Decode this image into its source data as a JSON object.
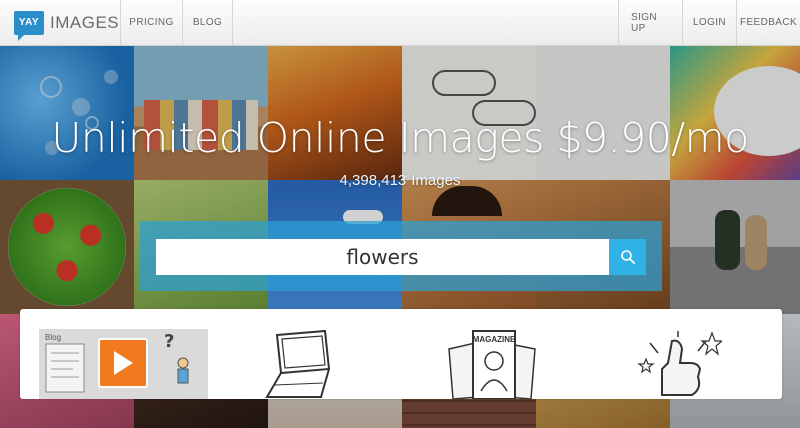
{
  "brand": {
    "logo_text": "YAY",
    "name": "IMAGES"
  },
  "nav": {
    "left": [
      {
        "id": "pricing",
        "label": "PRICING"
      },
      {
        "id": "blog",
        "label": "BLOG"
      }
    ],
    "right": [
      {
        "id": "signup",
        "label": "SIGN UP"
      },
      {
        "id": "login",
        "label": "LOGIN"
      },
      {
        "id": "feedback",
        "label": "FEEDBACK"
      }
    ]
  },
  "hero": {
    "headline": "Unlimited Online Images $9.90/mo",
    "image_count": "4,398,413",
    "image_count_suffix": "Images"
  },
  "search": {
    "value": "flowers",
    "button_icon": "search-icon"
  },
  "features": [
    {
      "id": "blog",
      "label": "Blog",
      "icon": "blog-video-illustration"
    },
    {
      "id": "laptop",
      "icon": "laptop-sketch-icon"
    },
    {
      "id": "magazine",
      "icon": "magazine-sketch-icon",
      "text": "MAGAZINE"
    },
    {
      "id": "thumbs-up",
      "icon": "thumbs-up-sketch-icon"
    }
  ],
  "colors": {
    "accent": "#30b2e6",
    "logo": "#2a8fc8",
    "blog_play": "#f2791e"
  },
  "mosaic_tiles": [
    "bubbles",
    "houses",
    "sunset",
    "cloud sketch",
    "cloud sketch",
    "colorful illustration",
    "salad",
    "green",
    "sky",
    "woman with sunglasses",
    "sepia",
    "couple on steps",
    "flowers",
    "dark",
    "portrait",
    "brick",
    "wheat",
    "buildings"
  ]
}
